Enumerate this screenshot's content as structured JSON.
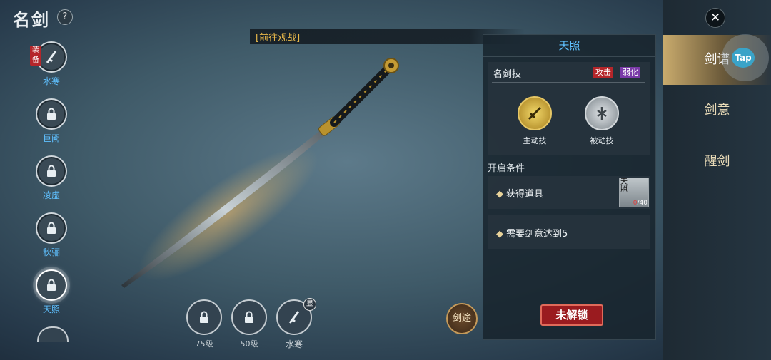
{
  "header": {
    "title": "名剑",
    "help_icon": "?"
  },
  "sword_list": [
    {
      "name": "水寒",
      "state": "equipped",
      "badge": "装备"
    },
    {
      "name": "巨阙",
      "state": "locked"
    },
    {
      "name": "凌虚",
      "state": "locked"
    },
    {
      "name": "秋骊",
      "state": "locked"
    },
    {
      "name": "天照",
      "state": "locked-selected"
    }
  ],
  "banner": {
    "text": "[前往观战]"
  },
  "bottom_slots": [
    {
      "label": "75级",
      "icon": "lock-icon"
    },
    {
      "label": "50级",
      "icon": "lock-icon"
    },
    {
      "label": "水寒",
      "icon": "sword-icon",
      "badge": "显"
    }
  ],
  "jiantu_label": "剑途",
  "panel": {
    "title": "天照",
    "skills_header": "名剑技",
    "tags": [
      "攻击",
      "弱化"
    ],
    "active_skill": "主动技",
    "passive_skill": "被动技",
    "conditions_header": "开启条件",
    "conditions": [
      {
        "text": "获得道具",
        "item": {
          "name": "天照",
          "current": "0",
          "total": "/40"
        }
      },
      {
        "text": "需要剑意达到5"
      }
    ],
    "unlock_button": "未解锁"
  },
  "right_tabs": [
    "剑谱",
    "剑意",
    "醒剑"
  ],
  "close_icon": "✕",
  "tap_label": "Tap",
  "colors": {
    "accent_blue": "#5fc0ff",
    "gold": "#e8b84a",
    "red_button": "#9a1b1f"
  }
}
